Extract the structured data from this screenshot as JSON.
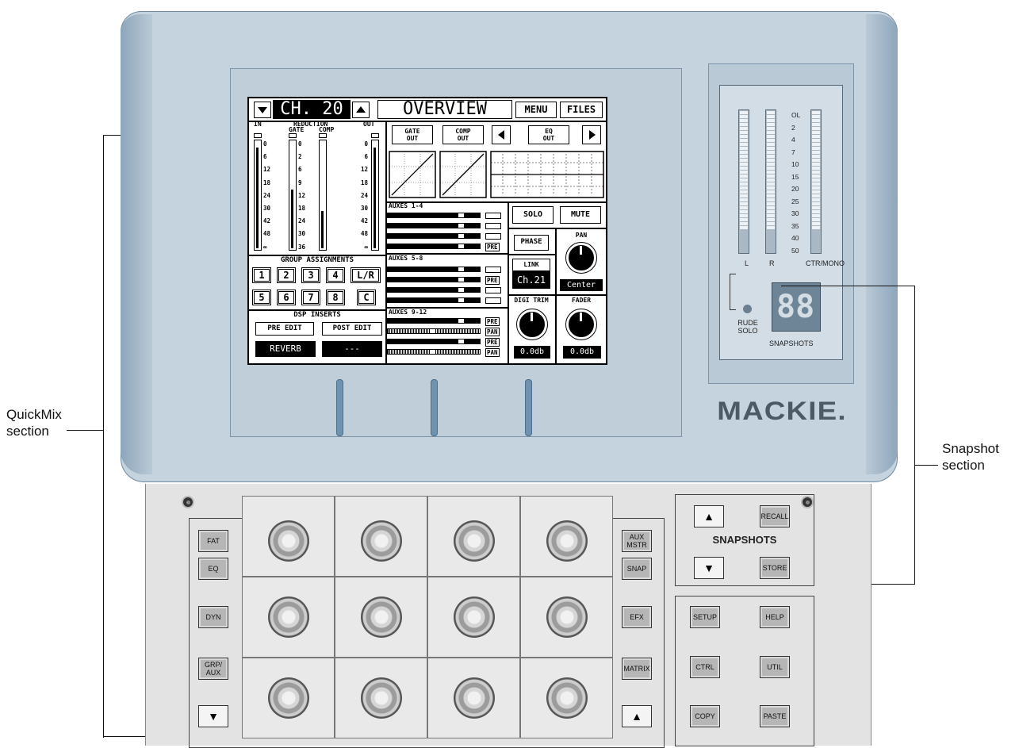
{
  "callouts": {
    "quickmix_line1": "QuickMix",
    "quickmix_line2": "section",
    "snapshot_line1": "Snapshot",
    "snapshot_line2": "section"
  },
  "brand": "MACKIE.",
  "meter": {
    "scale": [
      "OL",
      "2",
      "4",
      "7",
      "10",
      "15",
      "20",
      "25",
      "30",
      "35",
      "40",
      "50"
    ],
    "labels": {
      "left": "L",
      "right": "R",
      "ctr": "CTR/MONO"
    },
    "rude_solo": [
      "RUDE",
      "SOLO"
    ],
    "snapshots_label": "SNAPSHOTS",
    "snapshot_display": "88"
  },
  "lcd": {
    "channel": "CH. 20",
    "title": "OVERVIEW",
    "menu": "MENU",
    "files": "FILES",
    "meters_head": {
      "in": "IN",
      "reduction": "REDUCTION",
      "gate": "GATE",
      "comp": "COMP",
      "out": "OUT"
    },
    "in_scale": [
      "0",
      "6",
      "12",
      "18",
      "24",
      "30",
      "42",
      "48",
      "∞"
    ],
    "gate_scale": [
      "0",
      "2",
      "6",
      "9",
      "12",
      "18",
      "24",
      "30",
      "36"
    ],
    "out_scale": [
      "0",
      "6",
      "12",
      "18",
      "24",
      "30",
      "42",
      "48",
      "∞"
    ],
    "gate_out": [
      "GATE",
      "OUT"
    ],
    "comp_out": [
      "COMP",
      "OUT"
    ],
    "eq_out": [
      "EQ",
      "OUT"
    ],
    "auxes_1_4": "AUXES 1-4",
    "auxes_5_8": "AUXES 5-8",
    "auxes_9_12": "AUXES 9-12",
    "pre": "PRE",
    "pan": "PAN",
    "solo": "SOLO",
    "mute": "MUTE",
    "phase": "PHASE",
    "pan_label": "PAN",
    "link": "LINK",
    "link_value": "Ch.21",
    "pan_value": "Center",
    "digi_trim": "DIGI TRIM",
    "fader": "FADER",
    "trim_value": "0.0db",
    "fader_value": "0.0db",
    "group_assignments": "GROUP ASSIGNMENTS",
    "groups_row1": [
      "1",
      "2",
      "3",
      "4",
      "L/R"
    ],
    "groups_row2": [
      "5",
      "6",
      "7",
      "8",
      "C"
    ],
    "dsp_inserts": "DSP INSERTS",
    "pre_edit": "PRE EDIT",
    "post_edit": "POST EDIT",
    "pre_value": "REVERB",
    "post_value": "---"
  },
  "panel": {
    "left_buttons": [
      "FAT",
      "EQ",
      "DYN",
      "GRP/\nAUX"
    ],
    "right_buttons": [
      "AUX\nMSTR",
      "SNAP",
      "EFX",
      "MATRIX"
    ],
    "snapshots_title": "SNAPSHOTS",
    "recall": "RECALL",
    "store": "STORE",
    "util_buttons": [
      "SETUP",
      "HELP",
      "CTRL",
      "UTIL",
      "COPY",
      "PASTE"
    ]
  }
}
